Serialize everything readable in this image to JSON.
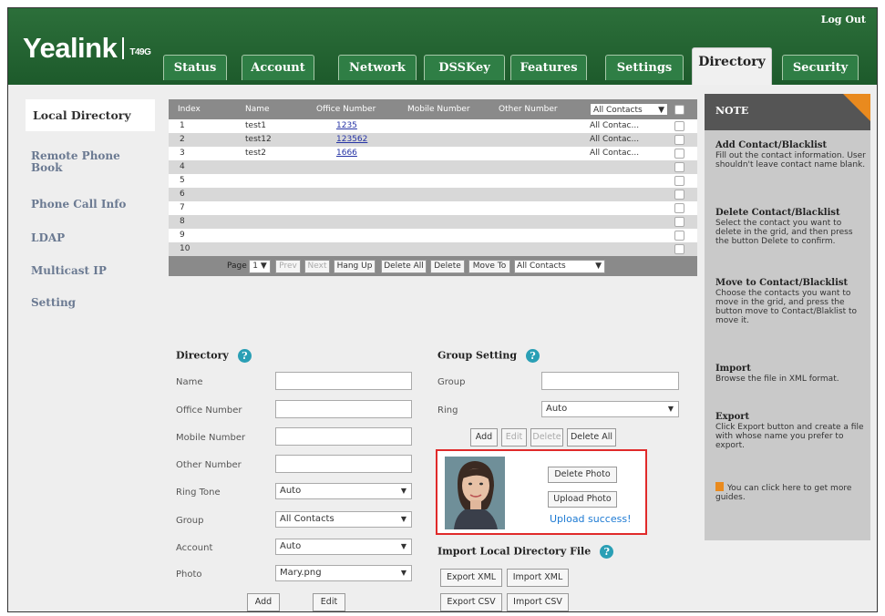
{
  "header": {
    "logo_text": "Yealink",
    "model": "T49G",
    "logout": "Log Out",
    "tabs": [
      "Status",
      "Account",
      "Network",
      "DSSKey",
      "Features",
      "Settings",
      "Directory",
      "Security"
    ],
    "active_tab": "Directory"
  },
  "sidebar": {
    "items": [
      "Local Directory",
      "Remote Phone Book",
      "Phone Call Info",
      "LDAP",
      "Multicast IP",
      "Setting"
    ],
    "active": "Local Directory"
  },
  "grid": {
    "headers": [
      "Index",
      "Name",
      "Office Number",
      "Mobile Number",
      "Other Number"
    ],
    "filter": "All Contacts",
    "rows": [
      {
        "index": "1",
        "name": "test1",
        "office": "1235",
        "group": "All Contac..."
      },
      {
        "index": "2",
        "name": "test12",
        "office": "123562",
        "group": "All Contac..."
      },
      {
        "index": "3",
        "name": "test2",
        "office": "1666",
        "group": "All Contac..."
      },
      {
        "index": "4",
        "name": "",
        "office": "",
        "group": ""
      },
      {
        "index": "5",
        "name": "",
        "office": "",
        "group": ""
      },
      {
        "index": "6",
        "name": "",
        "office": "",
        "group": ""
      },
      {
        "index": "7",
        "name": "",
        "office": "",
        "group": ""
      },
      {
        "index": "8",
        "name": "",
        "office": "",
        "group": ""
      },
      {
        "index": "9",
        "name": "",
        "office": "",
        "group": ""
      },
      {
        "index": "10",
        "name": "",
        "office": "",
        "group": ""
      }
    ]
  },
  "pager": {
    "page_label": "Page",
    "page_value": "1",
    "prev": "Prev",
    "next": "Next",
    "hang_up": "Hang Up",
    "delete_all": "Delete All",
    "delete": "Delete",
    "move_to": "Move To",
    "move_target": "All Contacts"
  },
  "directory_form": {
    "title": "Directory",
    "labels": {
      "name": "Name",
      "office": "Office Number",
      "mobile": "Mobile Number",
      "other": "Other Number",
      "ring_tone": "Ring Tone",
      "group": "Group",
      "account": "Account",
      "photo": "Photo"
    },
    "values": {
      "ring_tone": "Auto",
      "group": "All Contacts",
      "account": "Auto",
      "photo": "Mary.png"
    },
    "add": "Add",
    "edit": "Edit"
  },
  "group_setting": {
    "title": "Group Setting",
    "group_label": "Group",
    "ring_label": "Ring",
    "ring_value": "Auto",
    "add": "Add",
    "edit": "Edit",
    "delete": "Delete",
    "delete_all": "Delete All"
  },
  "photo_panel": {
    "delete_photo": "Delete Photo",
    "upload_photo": "Upload Photo",
    "status": "Upload success!"
  },
  "import_section": {
    "title": "Import Local Directory File",
    "export_xml": "Export XML",
    "import_xml": "Import XML",
    "export_csv": "Export CSV",
    "import_csv": "Import CSV"
  },
  "note": {
    "title": "NOTE",
    "sections": [
      {
        "heading": "Add Contact/Blacklist",
        "body": "Fill out the contact information. User shouldn't leave contact name blank."
      },
      {
        "heading": "Delete Contact/Blacklist",
        "body": "Select the contact you want to delete in the grid, and then press the button Delete to confirm."
      },
      {
        "heading": "Move to Contact/Blacklist",
        "body": "Choose the contacts you want to move in the grid, and press the button move to Contact/Blaklist to move it."
      },
      {
        "heading": "Import",
        "body": "Browse the file in XML format."
      },
      {
        "heading": "Export",
        "body": "Click Export button and create a file with whose name you prefer to export."
      }
    ],
    "guide": "You can click here to get more guides."
  },
  "colors": {
    "header_green": "#2c6f3a",
    "note_accent": "#e98a1e",
    "highlight_red": "#e02a2a",
    "link_blue": "#2533a5"
  }
}
